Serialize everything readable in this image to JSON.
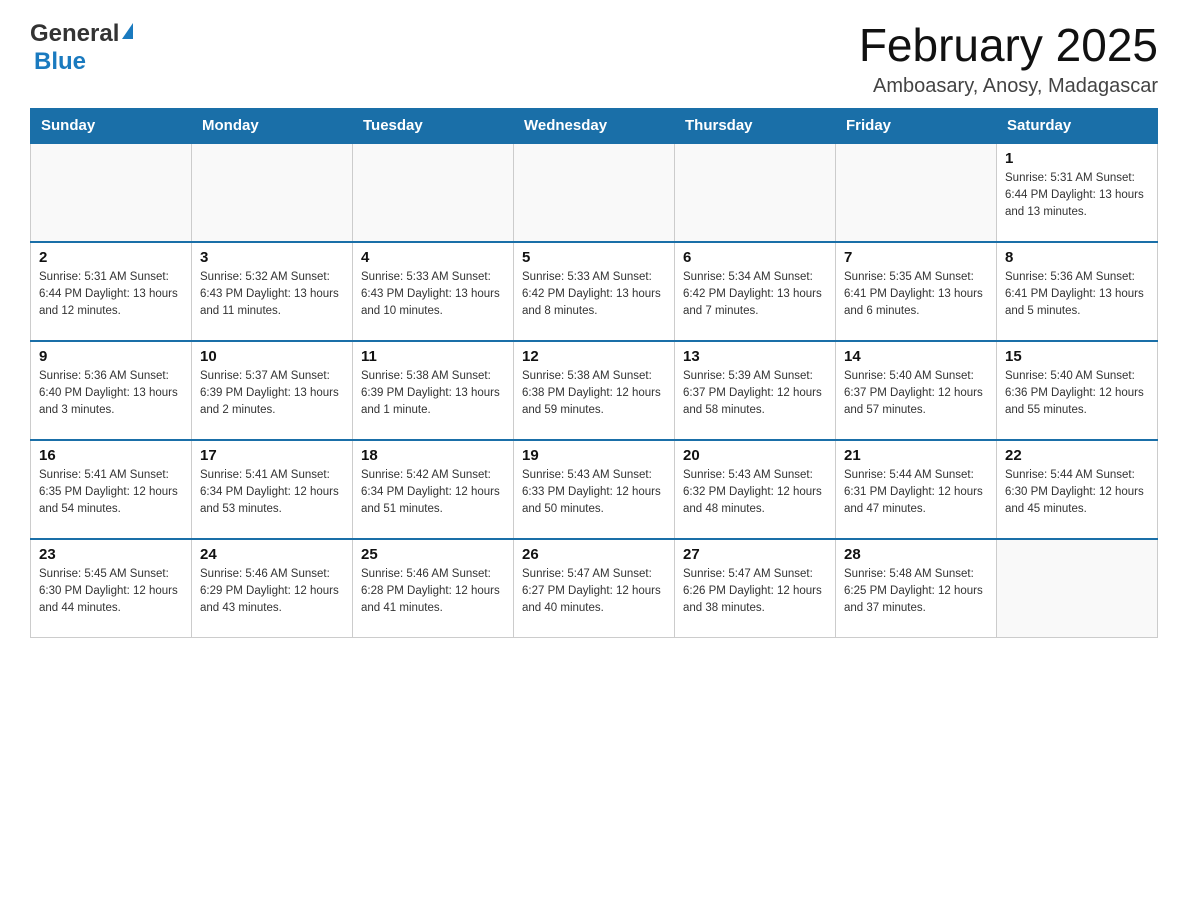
{
  "logo": {
    "general": "General",
    "blue": "Blue"
  },
  "title": "February 2025",
  "subtitle": "Amboasary, Anosy, Madagascar",
  "days_of_week": [
    "Sunday",
    "Monday",
    "Tuesday",
    "Wednesday",
    "Thursday",
    "Friday",
    "Saturday"
  ],
  "weeks": [
    [
      {
        "day": "",
        "info": ""
      },
      {
        "day": "",
        "info": ""
      },
      {
        "day": "",
        "info": ""
      },
      {
        "day": "",
        "info": ""
      },
      {
        "day": "",
        "info": ""
      },
      {
        "day": "",
        "info": ""
      },
      {
        "day": "1",
        "info": "Sunrise: 5:31 AM\nSunset: 6:44 PM\nDaylight: 13 hours\nand 13 minutes."
      }
    ],
    [
      {
        "day": "2",
        "info": "Sunrise: 5:31 AM\nSunset: 6:44 PM\nDaylight: 13 hours\nand 12 minutes."
      },
      {
        "day": "3",
        "info": "Sunrise: 5:32 AM\nSunset: 6:43 PM\nDaylight: 13 hours\nand 11 minutes."
      },
      {
        "day": "4",
        "info": "Sunrise: 5:33 AM\nSunset: 6:43 PM\nDaylight: 13 hours\nand 10 minutes."
      },
      {
        "day": "5",
        "info": "Sunrise: 5:33 AM\nSunset: 6:42 PM\nDaylight: 13 hours\nand 8 minutes."
      },
      {
        "day": "6",
        "info": "Sunrise: 5:34 AM\nSunset: 6:42 PM\nDaylight: 13 hours\nand 7 minutes."
      },
      {
        "day": "7",
        "info": "Sunrise: 5:35 AM\nSunset: 6:41 PM\nDaylight: 13 hours\nand 6 minutes."
      },
      {
        "day": "8",
        "info": "Sunrise: 5:36 AM\nSunset: 6:41 PM\nDaylight: 13 hours\nand 5 minutes."
      }
    ],
    [
      {
        "day": "9",
        "info": "Sunrise: 5:36 AM\nSunset: 6:40 PM\nDaylight: 13 hours\nand 3 minutes."
      },
      {
        "day": "10",
        "info": "Sunrise: 5:37 AM\nSunset: 6:39 PM\nDaylight: 13 hours\nand 2 minutes."
      },
      {
        "day": "11",
        "info": "Sunrise: 5:38 AM\nSunset: 6:39 PM\nDaylight: 13 hours\nand 1 minute."
      },
      {
        "day": "12",
        "info": "Sunrise: 5:38 AM\nSunset: 6:38 PM\nDaylight: 12 hours\nand 59 minutes."
      },
      {
        "day": "13",
        "info": "Sunrise: 5:39 AM\nSunset: 6:37 PM\nDaylight: 12 hours\nand 58 minutes."
      },
      {
        "day": "14",
        "info": "Sunrise: 5:40 AM\nSunset: 6:37 PM\nDaylight: 12 hours\nand 57 minutes."
      },
      {
        "day": "15",
        "info": "Sunrise: 5:40 AM\nSunset: 6:36 PM\nDaylight: 12 hours\nand 55 minutes."
      }
    ],
    [
      {
        "day": "16",
        "info": "Sunrise: 5:41 AM\nSunset: 6:35 PM\nDaylight: 12 hours\nand 54 minutes."
      },
      {
        "day": "17",
        "info": "Sunrise: 5:41 AM\nSunset: 6:34 PM\nDaylight: 12 hours\nand 53 minutes."
      },
      {
        "day": "18",
        "info": "Sunrise: 5:42 AM\nSunset: 6:34 PM\nDaylight: 12 hours\nand 51 minutes."
      },
      {
        "day": "19",
        "info": "Sunrise: 5:43 AM\nSunset: 6:33 PM\nDaylight: 12 hours\nand 50 minutes."
      },
      {
        "day": "20",
        "info": "Sunrise: 5:43 AM\nSunset: 6:32 PM\nDaylight: 12 hours\nand 48 minutes."
      },
      {
        "day": "21",
        "info": "Sunrise: 5:44 AM\nSunset: 6:31 PM\nDaylight: 12 hours\nand 47 minutes."
      },
      {
        "day": "22",
        "info": "Sunrise: 5:44 AM\nSunset: 6:30 PM\nDaylight: 12 hours\nand 45 minutes."
      }
    ],
    [
      {
        "day": "23",
        "info": "Sunrise: 5:45 AM\nSunset: 6:30 PM\nDaylight: 12 hours\nand 44 minutes."
      },
      {
        "day": "24",
        "info": "Sunrise: 5:46 AM\nSunset: 6:29 PM\nDaylight: 12 hours\nand 43 minutes."
      },
      {
        "day": "25",
        "info": "Sunrise: 5:46 AM\nSunset: 6:28 PM\nDaylight: 12 hours\nand 41 minutes."
      },
      {
        "day": "26",
        "info": "Sunrise: 5:47 AM\nSunset: 6:27 PM\nDaylight: 12 hours\nand 40 minutes."
      },
      {
        "day": "27",
        "info": "Sunrise: 5:47 AM\nSunset: 6:26 PM\nDaylight: 12 hours\nand 38 minutes."
      },
      {
        "day": "28",
        "info": "Sunrise: 5:48 AM\nSunset: 6:25 PM\nDaylight: 12 hours\nand 37 minutes."
      },
      {
        "day": "",
        "info": ""
      }
    ]
  ]
}
